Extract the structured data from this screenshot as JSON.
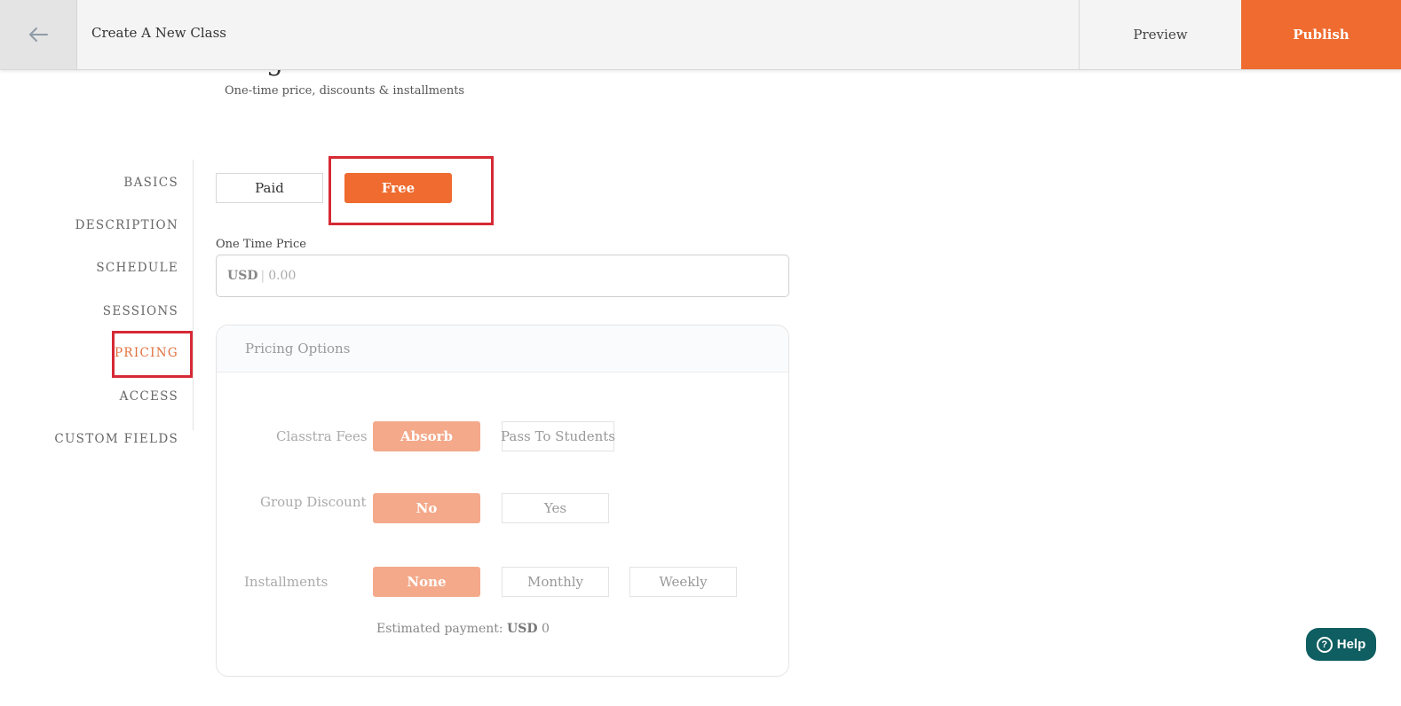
{
  "topbar": {
    "back_icon": "arrow-left-icon",
    "title": "Create A New Class",
    "preview_label": "Preview",
    "publish_label": "Publish",
    "accent_color": "#ef6b2f"
  },
  "section": {
    "heading_fragment": "g",
    "subtitle": "One-time price, discounts & installments"
  },
  "nav": {
    "items": [
      {
        "label": "BASICS"
      },
      {
        "label": "DESCRIPTION"
      },
      {
        "label": "SCHEDULE"
      },
      {
        "label": "SESSIONS"
      },
      {
        "label": "PRICING",
        "active": true
      },
      {
        "label": "ACCESS"
      },
      {
        "label": "CUSTOM FIELDS"
      }
    ]
  },
  "pricing_type": {
    "paid_label": "Paid",
    "free_label": "Free",
    "selected": "Free"
  },
  "one_time_price": {
    "label": "One Time Price",
    "currency": "USD",
    "placeholder": "0.00"
  },
  "pricing_options": {
    "title": "Pricing Options",
    "classtra_fees": {
      "label": "Classtra Fees",
      "options": [
        "Absorb",
        "Pass To Students"
      ],
      "selected": "Absorb"
    },
    "group_discount": {
      "label": "Group Discount",
      "options": [
        "No",
        "Yes"
      ],
      "selected": "No"
    },
    "installments": {
      "label": "Installments",
      "options": [
        "None",
        "Monthly",
        "Weekly"
      ],
      "selected": "None"
    },
    "estimate_label": "Estimated payment:",
    "estimate_currency": "USD",
    "estimate_value": "0"
  },
  "help": {
    "icon": "question-circle-icon",
    "label": "Help"
  }
}
